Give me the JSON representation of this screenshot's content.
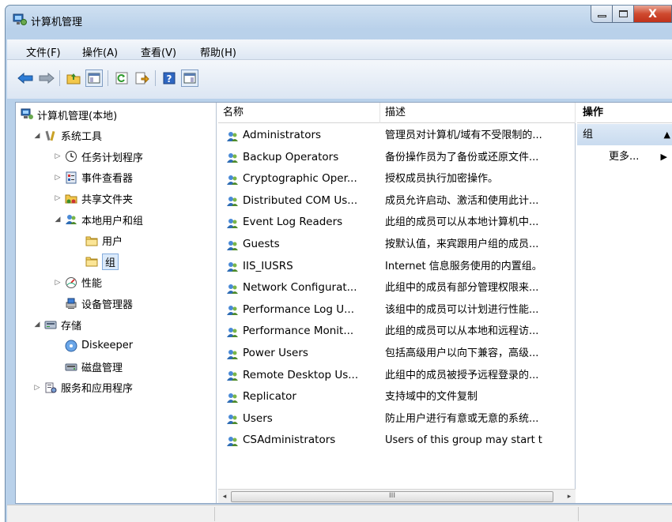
{
  "window": {
    "title": "计算机管理",
    "icon": "computer-management-icon"
  },
  "caption_buttons": {
    "minimize_icon": "minimize-icon",
    "maximize_icon": "maximize-icon",
    "close_label": "X"
  },
  "menu": [
    "文件(F)",
    "操作(A)",
    "查看(V)",
    "帮助(H)"
  ],
  "toolbar": [
    "back-arrow-icon",
    "forward-arrow-icon",
    "up-folder-icon",
    "show-hide-console-tree-icon",
    "refresh-icon",
    "export-list-icon",
    "help-icon",
    "show-hide-action-pane-icon"
  ],
  "tree": [
    {
      "label": "计算机管理(本地)",
      "icon": "computer-management-icon",
      "level": 0,
      "expander": ""
    },
    {
      "label": "系统工具",
      "icon": "tools-icon",
      "level": 1,
      "expander": "expanded"
    },
    {
      "label": "任务计划程序",
      "icon": "clock-icon",
      "level": 2,
      "expander": "collapsed"
    },
    {
      "label": "事件查看器",
      "icon": "event-viewer-icon",
      "level": 2,
      "expander": "collapsed"
    },
    {
      "label": "共享文件夹",
      "icon": "shared-folder-icon",
      "level": 2,
      "expander": "collapsed"
    },
    {
      "label": "本地用户和组",
      "icon": "users-icon",
      "level": 2,
      "expander": "expanded"
    },
    {
      "label": "用户",
      "icon": "folder-icon",
      "level": 3,
      "expander": ""
    },
    {
      "label": "组",
      "icon": "folder-icon",
      "level": 3,
      "expander": "",
      "selected": true
    },
    {
      "label": "性能",
      "icon": "performance-icon",
      "level": 2,
      "expander": "collapsed"
    },
    {
      "label": "设备管理器",
      "icon": "device-manager-icon",
      "level": 2,
      "expander": ""
    },
    {
      "label": "存储",
      "icon": "storage-icon",
      "level": 1,
      "expander": "expanded"
    },
    {
      "label": "Diskeeper",
      "icon": "diskeeper-icon",
      "level": 2,
      "expander": ""
    },
    {
      "label": "磁盘管理",
      "icon": "disk-management-icon",
      "level": 2,
      "expander": ""
    },
    {
      "label": "服务和应用程序",
      "icon": "services-icon",
      "level": 1,
      "expander": "collapsed"
    }
  ],
  "list": {
    "columns": [
      "名称",
      "描述"
    ],
    "rows": [
      {
        "name": "Administrators",
        "desc": "管理员对计算机/域有不受限制的..."
      },
      {
        "name": "Backup Operators",
        "desc": "备份操作员为了备份或还原文件..."
      },
      {
        "name": "Cryptographic Oper...",
        "desc": "授权成员执行加密操作。"
      },
      {
        "name": "Distributed COM Us...",
        "desc": "成员允许启动、激活和使用此计..."
      },
      {
        "name": "Event Log Readers",
        "desc": "此组的成员可以从本地计算机中..."
      },
      {
        "name": "Guests",
        "desc": "按默认值，来宾跟用户组的成员..."
      },
      {
        "name": "IIS_IUSRS",
        "desc": "Internet 信息服务使用的内置组。"
      },
      {
        "name": "Network Configurat...",
        "desc": "此组中的成员有部分管理权限来..."
      },
      {
        "name": "Performance Log U...",
        "desc": "该组中的成员可以计划进行性能..."
      },
      {
        "name": "Performance Monit...",
        "desc": "此组的成员可以从本地和远程访..."
      },
      {
        "name": "Power Users",
        "desc": "包括高级用户以向下兼容，高级..."
      },
      {
        "name": "Remote Desktop Us...",
        "desc": "此组中的成员被授予远程登录的..."
      },
      {
        "name": "Replicator",
        "desc": "支持域中的文件复制"
      },
      {
        "name": "Users",
        "desc": "防止用户进行有意或无意的系统..."
      },
      {
        "name": "CSAdministrators",
        "desc": "Users of this group may start t"
      }
    ],
    "row_icon": "group-icon",
    "hscroll": {
      "left": "◂",
      "right": "▸",
      "grip": "III"
    }
  },
  "actions": {
    "header": "操作",
    "group_label": "组",
    "group_arrow": "▲",
    "more_label": "更多...",
    "more_arrow": "▶"
  },
  "colors": {
    "accent": "#3399ff",
    "selection": "#dbeafb",
    "frame": "#b9d1ea"
  }
}
